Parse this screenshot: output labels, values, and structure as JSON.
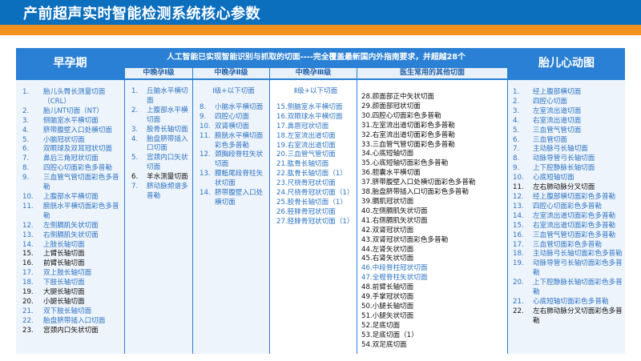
{
  "header": {
    "title": "产前超声实时智能检测系统核心参数"
  },
  "colors": {
    "header_blue": "#0B6FBE",
    "accent_orange": "#F2911E",
    "panel_blue": "#2A80D4",
    "link_blue": "#2D74C4",
    "dark_text": "#111111"
  },
  "table": {
    "early_title": "早孕期",
    "ai_banner": "人工智能已实现智能识别与抓取的切面----完全覆盖最新国内外指南要求，并超越28个",
    "heart_title": "胎儿心动图",
    "sub_headers": [
      "中晚孕Ⅰ级",
      "中晚孕Ⅱ级",
      "中晚孕Ⅲ级",
      "医生常用的其他切面"
    ],
    "early_items": [
      {
        "n": "1.",
        "t": "胎儿头臀长测量切面（CRL）",
        "dark": false
      },
      {
        "n": "2.",
        "t": "胎儿NT切面（NT）",
        "dark": false
      },
      {
        "n": "3.",
        "t": "侧脑室水平横切面",
        "dark": false
      },
      {
        "n": "4.",
        "t": "脐带腹壁入口处横切面",
        "dark": false
      },
      {
        "n": "5.",
        "t": "小脑冠状切面",
        "dark": false
      },
      {
        "n": "6.",
        "t": "双眼球及双耳冠状切面",
        "dark": false
      },
      {
        "n": "7.",
        "t": "鼻后三角冠状切面",
        "dark": false
      },
      {
        "n": "8.",
        "t": "四腔心切面彩色多普勒",
        "dark": false
      },
      {
        "n": "9.",
        "t": "三血管气管切面彩色多普勒",
        "dark": false
      },
      {
        "n": "10.",
        "t": "上腹部水平横切面",
        "dark": false
      },
      {
        "n": "11.",
        "t": "膀胱水平横切面彩色多普勒",
        "dark": false
      },
      {
        "n": "12.",
        "t": "左侧膈肌矢状切面",
        "dark": false
      },
      {
        "n": "13.",
        "t": "右侧膈肌矢状切面",
        "dark": false
      },
      {
        "n": "14.",
        "t": "上肢长轴切面",
        "dark": false
      },
      {
        "n": "15.",
        "t": "上臂长轴切面",
        "dark": true
      },
      {
        "n": "16.",
        "t": "前臂长轴切面",
        "dark": true
      },
      {
        "n": "17.",
        "t": "双上肢长轴切面",
        "dark": false
      },
      {
        "n": "18.",
        "t": "下肢长轴切面",
        "dark": false
      },
      {
        "n": "19.",
        "t": "大腿长轴切面",
        "dark": true
      },
      {
        "n": "20.",
        "t": "小腿长轴切面",
        "dark": true
      },
      {
        "n": "21.",
        "t": "双下肢长轴切面",
        "dark": false
      },
      {
        "n": "22.",
        "t": "胎盘脐带插入口切面",
        "dark": false
      },
      {
        "n": "23.",
        "t": "宫颈内口矢状切面",
        "dark": true
      }
    ],
    "level1_items": [
      {
        "n": "1.",
        "t": "丘脑水平横切面",
        "dark": false
      },
      {
        "n": "2.",
        "t": "上腹部水平横切面",
        "dark": false
      },
      {
        "n": "3.",
        "t": "股骨长轴切面",
        "dark": false
      },
      {
        "n": "4.",
        "t": "胎盘脐带插入口切面",
        "dark": false
      },
      {
        "n": "5.",
        "t": "宫颈内口矢状切面",
        "dark": false
      },
      {
        "n": "6.",
        "t": "羊水测量切面",
        "dark": true
      },
      {
        "n": "7.",
        "t": "脐动脉频谱多普勒",
        "dark": false
      }
    ],
    "level2_intro": "Ⅰ级+以下切面",
    "level2_items": [
      {
        "n": "8.",
        "t": "小脑水平横切面",
        "dark": false
      },
      {
        "n": "9.",
        "t": "四腔心切面",
        "dark": false
      },
      {
        "n": "10.",
        "t": "双肾横切面",
        "dark": false
      },
      {
        "n": "11.",
        "t": "膀胱水平横切面彩色多普勒",
        "dark": false
      },
      {
        "n": "12.",
        "t": "颈胸段脊柱矢状切面",
        "dark": false
      },
      {
        "n": "13.",
        "t": "腰骶尾段脊柱矢状切面",
        "dark": false
      },
      {
        "n": "14.",
        "t": "脐带腹壁入口处横切面",
        "dark": false
      }
    ],
    "level3_intro": "Ⅱ级+以下切面",
    "level3_items": [
      {
        "t": "15.侧脑室水平横切面",
        "dark": false
      },
      {
        "t": "16.双眼球水平横切面",
        "dark": false
      },
      {
        "t": "17.鼻唇冠状切面",
        "dark": false
      },
      {
        "t": "18.左室流出道切面",
        "dark": false
      },
      {
        "t": "19.右室流出道切面",
        "dark": false
      },
      {
        "t": "20.三血管气管切面",
        "dark": false
      },
      {
        "t": "21.肱骨长轴切面",
        "dark": false
      },
      {
        "t": "22.肱骨长轴切面（1）",
        "dark": false
      },
      {
        "t": "23.尺桡骨冠状切面",
        "dark": false
      },
      {
        "t": "24.尺桡骨冠状切面（1）",
        "dark": false
      },
      {
        "t": "25.股骨长轴切面（1）",
        "dark": false
      },
      {
        "t": "26.胫腓骨冠状切面",
        "dark": false
      },
      {
        "t": "27.胫腓骨冠状切面（1）",
        "dark": false
      }
    ],
    "other_items": [
      {
        "t": "28.颜面部正中矢状切面",
        "dark": true
      },
      {
        "t": "29.颜面部冠状切面",
        "dark": true
      },
      {
        "t": "30.四腔心切面彩色多普勒",
        "dark": true
      },
      {
        "t": "31.左室流出道切面彩色多普勒",
        "dark": true
      },
      {
        "t": "32.右室流出道切面彩色多普勒",
        "dark": true
      },
      {
        "t": "33.三血管气管切面彩色多普勒",
        "dark": true
      },
      {
        "t": "34.心底短轴切面",
        "dark": true
      },
      {
        "t": "35.心底短轴切面彩色多普勒",
        "dark": true
      },
      {
        "t": "36.胆囊水平横切面",
        "dark": true
      },
      {
        "t": "37.脐带腹壁入口处横切面彩色多普勒",
        "dark": true
      },
      {
        "t": "38.胎盘脐带插入口切面彩色多普勒",
        "dark": true
      },
      {
        "t": "39.膈肌冠状切面",
        "dark": true
      },
      {
        "t": "40.左侧膈肌矢状切面",
        "dark": true
      },
      {
        "t": "41.右侧膈肌矢状切面",
        "dark": true
      },
      {
        "t": "42.双肾冠状切面",
        "dark": true
      },
      {
        "t": "43.双肾冠状切面彩色多普勒",
        "dark": true
      },
      {
        "t": "44.左肾矢状切面",
        "dark": true
      },
      {
        "t": "45.右肾矢状切面",
        "dark": true
      },
      {
        "t": "46.中段脊柱冠状切面",
        "dark": false
      },
      {
        "t": "47.全程脊柱矢状切面",
        "dark": false
      },
      {
        "t": "48.前臂长轴切面",
        "dark": true
      },
      {
        "t": "49.手掌冠状切面",
        "dark": true
      },
      {
        "t": "50.小腿长轴切面",
        "dark": true
      },
      {
        "t": "51.小腿矢状切面",
        "dark": true
      },
      {
        "t": "52.足底切面",
        "dark": true
      },
      {
        "t": "53.足底切面（1）",
        "dark": true
      },
      {
        "t": "54.双足底切面",
        "dark": true
      }
    ],
    "heart_items": [
      {
        "n": "1.",
        "t": "经上腹部横切面",
        "dark": false
      },
      {
        "n": "2.",
        "t": "四腔心切面",
        "dark": false
      },
      {
        "n": "3.",
        "t": "左室流出道切面",
        "dark": false
      },
      {
        "n": "4.",
        "t": "右室流出道切面",
        "dark": false
      },
      {
        "n": "5.",
        "t": "三血管气管切面",
        "dark": false
      },
      {
        "n": "6.",
        "t": "三血管切面",
        "dark": false
      },
      {
        "n": "7.",
        "t": "主动脉弓长轴切面",
        "dark": false
      },
      {
        "n": "8.",
        "t": "动脉导管弓长轴切面",
        "dark": false
      },
      {
        "n": "9.",
        "t": "上下腔静脉长轴切面",
        "dark": false
      },
      {
        "n": "10.",
        "t": "心底短轴切面",
        "dark": false
      },
      {
        "n": "11.",
        "t": "左右肺动脉分叉切面",
        "dark": true
      },
      {
        "n": "12.",
        "t": "经上腹部横切面彩色多普勒",
        "dark": false
      },
      {
        "n": "13.",
        "t": "四腔心切面彩色多普勒",
        "dark": false
      },
      {
        "n": "14.",
        "t": "左室流出道切面彩色多普勒",
        "dark": false
      },
      {
        "n": "15.",
        "t": "右室流出道切面彩色多普勒",
        "dark": false
      },
      {
        "n": "16.",
        "t": "三血管气管切面彩色多普勒",
        "dark": false
      },
      {
        "n": "17.",
        "t": "三血管切面彩色多普勒",
        "dark": false
      },
      {
        "n": "18.",
        "t": "主动脉弓长轴切面彩色多普勒",
        "dark": false
      },
      {
        "n": "19.",
        "t": "动脉导管弓长轴切面彩色多普勒",
        "dark": false
      },
      {
        "n": "20.",
        "t": "上下腔静脉长轴切面彩色多普勒",
        "dark": false
      },
      {
        "n": "21.",
        "t": "心底短轴切面彩色多普勒",
        "dark": false
      },
      {
        "n": "22.",
        "t": "左右肺动脉分叉切面彩色多普勒",
        "dark": true
      }
    ]
  }
}
